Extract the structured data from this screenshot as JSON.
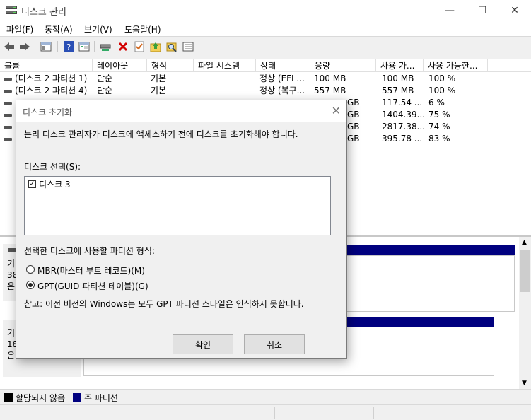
{
  "window": {
    "title": "디스크 관리",
    "minimize_glyph": "—",
    "maximize_glyph": "☐",
    "close_glyph": "✕"
  },
  "menu": [
    "파일(F)",
    "동작(A)",
    "보기(V)",
    "도움말(H)"
  ],
  "toolbar": {
    "icons": [
      "back-arrow-icon",
      "forward-arrow-icon",
      "show-hide-console-tree-icon",
      "help-icon",
      "properties-icon",
      "connect-icon",
      "delete-icon",
      "checklist-icon",
      "up-folder-icon",
      "search-icon",
      "list-icon"
    ]
  },
  "table": {
    "columns": [
      "볼륨",
      "레이아웃",
      "형식",
      "파일 시스템",
      "상태",
      "용량",
      "사용 가...",
      "사용 가능한..."
    ],
    "rows": [
      [
        "(디스크 2 파티션 1)",
        "단순",
        "기본",
        "",
        "정상 (EFI ...",
        "100 MB",
        "100 MB",
        "100 %"
      ],
      [
        "(디스크 2 파티션 4)",
        "단순",
        "기본",
        "",
        "정상 (복구...",
        "557 MB",
        "557 MB",
        "100 %"
      ],
      [
        "",
        "",
        "",
        "",
        "",
        "GB",
        "117.54 ...",
        "6 %"
      ],
      [
        "",
        "",
        "",
        "",
        "",
        "GB",
        "1404.39...",
        "75 %"
      ],
      [
        "",
        "",
        "",
        "",
        "",
        "GB",
        "2817.38...",
        "74 %"
      ],
      [
        "",
        "",
        "",
        "",
        "",
        "GB",
        "395.78 ...",
        "83 %"
      ]
    ]
  },
  "lower_pane": {
    "disk_a_lines": [
      "기",
      "38",
      "온"
    ],
    "disk_b_lines": [
      "기",
      "18",
      "온"
    ]
  },
  "legend": {
    "unallocated": "할당되지 않음",
    "primary": "주 파티션",
    "unallocated_color": "#000000",
    "primary_color": "#00007f"
  },
  "dialog": {
    "title": "디스크 초기화",
    "close_glyph": "✕",
    "intro": "논리 디스크 관리자가 디스크에 액세스하기 전에 디스크를 초기화해야 합니다.",
    "select_label": "디스크 선택(S):",
    "disk_item": "디스크 3",
    "disk_checked_glyph": "✓",
    "partition_label": "선택한 디스크에 사용할 파티션 형식:",
    "mbr_label": "MBR(마스터 부트 레코드)(M)",
    "gpt_label": "GPT(GUID 파티션 테이블)(G)",
    "note": "참고: 이전 버전의 Windows는 모두 GPT 파티션 스타일은 인식하지 못합니다.",
    "ok_label": "확인",
    "cancel_label": "취소",
    "selected_style": "GPT"
  }
}
